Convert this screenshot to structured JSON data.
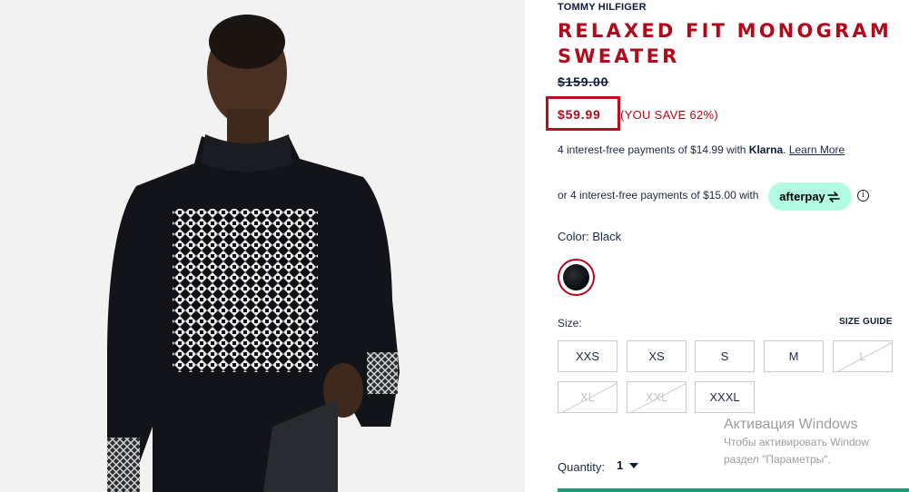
{
  "product": {
    "brand": "TOMMY HILFIGER",
    "title": "RELAXED FIT MONOGRAM SWEATER",
    "old_price": "$159.00",
    "sale_price": "$59.99",
    "you_save": "(YOU SAVE 62%)"
  },
  "payments": {
    "klarna_text": "4 interest-free payments of $14.99 with ",
    "klarna_brand": "Klarna",
    "klarna_sep": ".",
    "learn_more": "Learn More",
    "afterpay_text": "or 4 interest-free payments of $15.00 with",
    "afterpay_brand": "afterpay",
    "info_glyph": "i"
  },
  "color": {
    "label": "Color:",
    "value": "Black",
    "swatch_color": "#0d0f14"
  },
  "size": {
    "label": "Size:",
    "guide": "SIZE GUIDE",
    "options": [
      {
        "label": "XXS",
        "available": true
      },
      {
        "label": "XS",
        "available": true
      },
      {
        "label": "S",
        "available": true
      },
      {
        "label": "M",
        "available": true
      },
      {
        "label": "L",
        "available": false
      },
      {
        "label": "XL",
        "available": false
      },
      {
        "label": "XXL",
        "available": false
      },
      {
        "label": "XXXL",
        "available": true
      }
    ]
  },
  "quantity": {
    "label": "Quantity:",
    "value": "1"
  },
  "watermark": {
    "title": "Активация Windows",
    "line1": "Чтобы активировать Window",
    "line2": "раздел \"Параметры\"."
  },
  "colors": {
    "accent_red": "#b4091b",
    "navy": "#0c1c3c",
    "afterpay_mint": "#b2fce4",
    "cta_green": "#1f9a78"
  }
}
